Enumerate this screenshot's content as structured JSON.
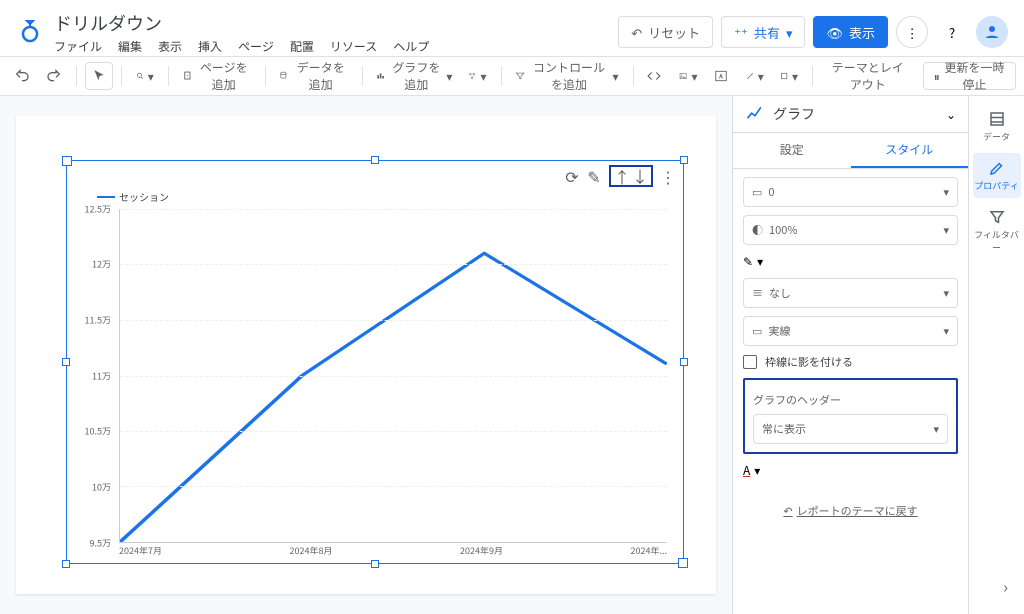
{
  "doc_title": "ドリルダウン",
  "menu": [
    "ファイル",
    "編集",
    "表示",
    "挿入",
    "ページ",
    "配置",
    "リソース",
    "ヘルプ"
  ],
  "header_buttons": {
    "reset": "リセット",
    "share": "共有",
    "view": "表示"
  },
  "toolbar": {
    "add_page": "ページを追加",
    "add_data": "データを追加",
    "add_chart": "グラフを追加",
    "add_control": "コントロールを追加",
    "theme": "テーマとレイアウト",
    "pause": "更新を一時停止"
  },
  "chart_data": {
    "type": "line",
    "title": "",
    "legend": "セッション",
    "categories": [
      "2024年7月",
      "2024年8月",
      "2024年9月",
      "2024年..."
    ],
    "values": [
      9.5,
      11.0,
      12.1,
      11.1
    ],
    "unit": "万",
    "ylim": [
      9.5,
      12.5
    ],
    "y_ticks": [
      "12.5万",
      "12万",
      "11.5万",
      "11万",
      "10.5万",
      "10万",
      "9.5万"
    ]
  },
  "panel": {
    "title": "グラフ",
    "tab_setup": "設定",
    "tab_style": "スタイル",
    "border_weight": "0",
    "opacity": "100%",
    "border_style": "なし",
    "line_style": "実線",
    "shadow_label": "枠線に影を付ける",
    "header_section": "グラフのヘッダー",
    "header_mode": "常に表示",
    "reset_theme": "レポートのテーマに戻す"
  },
  "rail": {
    "data": "データ",
    "property": "プロパティ",
    "filter": "フィルタバー"
  }
}
